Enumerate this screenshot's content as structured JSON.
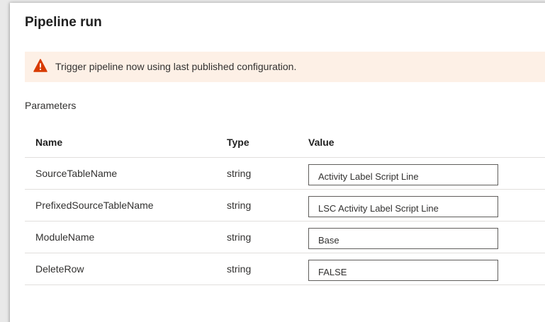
{
  "dialog": {
    "title": "Pipeline run"
  },
  "warning": {
    "icon": "warning-icon",
    "icon_color": "#d83b01",
    "background": "#fdf0e6",
    "text": "Trigger pipeline now using last published configuration."
  },
  "parameters": {
    "section_label": "Parameters",
    "columns": {
      "name": "Name",
      "type": "Type",
      "value": "Value"
    },
    "rows": [
      {
        "name": "SourceTableName",
        "type": "string",
        "value": "Activity Label Script Line"
      },
      {
        "name": "PrefixedSourceTableName",
        "type": "string",
        "value": "LSC Activity Label Script Line"
      },
      {
        "name": "ModuleName",
        "type": "string",
        "value": "Base"
      },
      {
        "name": "DeleteRow",
        "type": "string",
        "value": "FALSE"
      }
    ]
  }
}
